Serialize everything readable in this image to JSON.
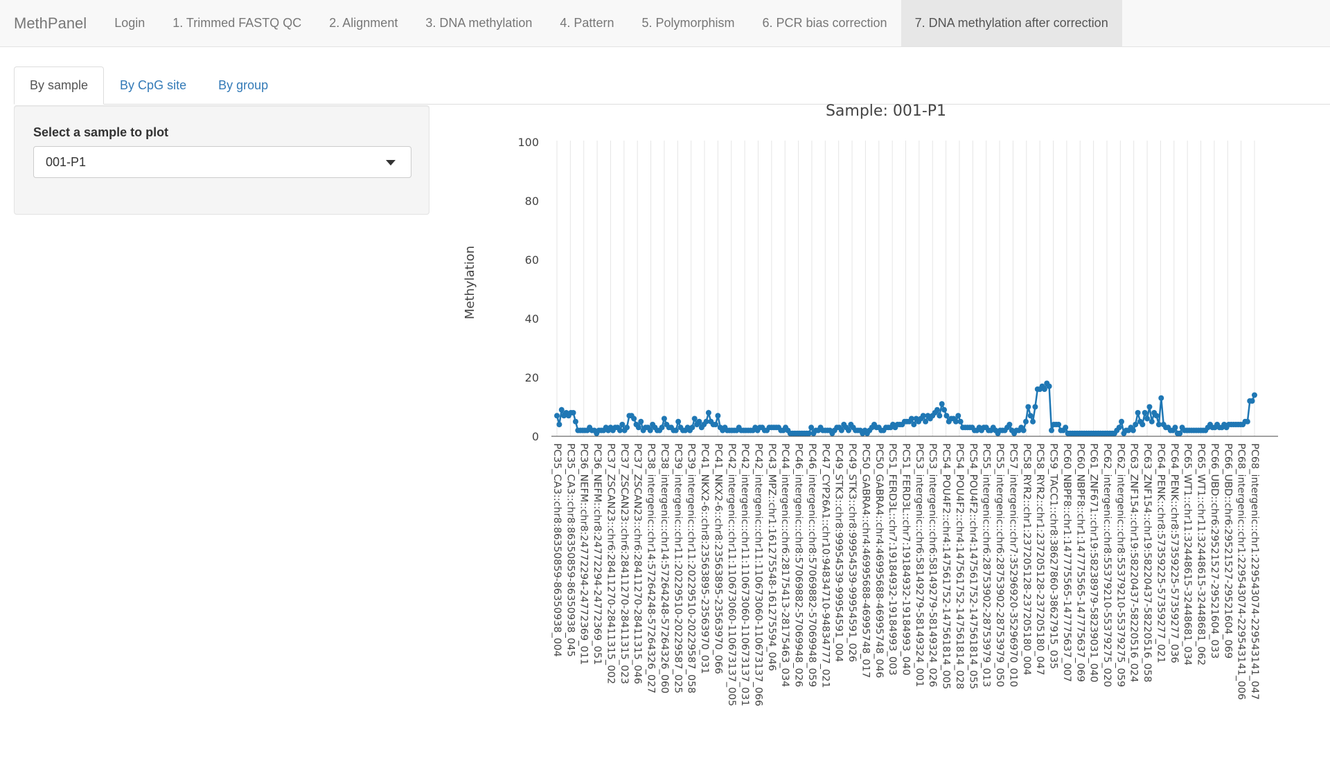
{
  "navbar": {
    "brand": "MethPanel",
    "items": [
      {
        "label": "Login"
      },
      {
        "label": "1. Trimmed FASTQ QC"
      },
      {
        "label": "2. Alignment"
      },
      {
        "label": "3. DNA methylation"
      },
      {
        "label": "4. Pattern"
      },
      {
        "label": "5. Polymorphism"
      },
      {
        "label": "6. PCR bias correction"
      },
      {
        "label": "7. DNA methylation after correction"
      }
    ],
    "active_index": 7
  },
  "tabs": [
    {
      "label": "By sample"
    },
    {
      "label": "By CpG site"
    },
    {
      "label": "By group"
    }
  ],
  "sidebar": {
    "label": "Select a sample to plot",
    "selected": "001-P1"
  },
  "colors": {
    "line": "#1f77b4",
    "grid": "#e5e5e5",
    "link": "#337ab7"
  },
  "chart_data": {
    "type": "line",
    "title": "Sample: 001-P1",
    "xlabel": "",
    "ylabel": "Methylation",
    "ylim": [
      0,
      100
    ],
    "yticks": [
      0,
      20,
      40,
      60,
      80,
      100
    ],
    "grid": "vertical",
    "markers": true,
    "x_tick_labels": [
      "PC35_CA3::chr8:86350859-86350938_004",
      "PC35_CA3::chr8:86350859-86350938_045",
      "PC36_NEFM::chr8:24772294-24772369_011",
      "PC36_NEFM::chr8:24772294-24772369_051",
      "PC37_ZSCAN23::chr6:28411270-28411315_002",
      "PC37_ZSCAN23::chr6:28411270-28411315_023",
      "PC37_ZSCAN23::chr6:28411270-28411315_046",
      "PC38_intergenic::chr14:57264248-57264326_027",
      "PC38_intergenic::chr14:57264248-57264326_060",
      "PC39_intergenic::chr11:20229510-20229587_025",
      "PC39_intergenic::chr11:20229510-20229587_058",
      "PC41_NKX2-6::chr8:23563895-23563970_031",
      "PC41_NKX2-6::chr8:23563895-23563970_066",
      "PC42_intergenic::chr11:110673060-110673137_005",
      "PC42_intergenic::chr11:110673060-110673137_031",
      "PC42_intergenic::chr11:110673060-110673137_066",
      "PC43_MPZ::chr1:161275548-161275594_046",
      "PC44_intergenic::chr6:28175413-28175463_034",
      "PC46_intergenic::chr8:57069882-57069948_026",
      "PC46_intergenic::chr8:57069882-57069948_059",
      "PC47_CYP26A1::chr10:94834710-94834777_021",
      "PC49_STK3::chr8:99954539-99954591_004",
      "PC49_STK3::chr8:99954539-99954591_026",
      "PC50_GABRA4::chr4:46995688-46995748_017",
      "PC50_GABRA4::chr4:46995688-46995748_046",
      "PC51_FERD3L::chr7:19184932-19184993_003",
      "PC51_FERD3L::chr7:19184932-19184993_040",
      "PC53_intergenic::chr6:58149279-58149324_001",
      "PC53_intergenic::chr6:58149279-58149324_026",
      "PC54_POU4F2::chr4:147561752-147561814_005",
      "PC54_POU4F2::chr4:147561752-147561814_028",
      "PC54_POU4F2::chr4:147561752-147561814_055",
      "PC55_intergenic::chr6:28753902-28753979_013",
      "PC55_intergenic::chr6:28753902-28753979_050",
      "PC57_intergenic::chr7:35296920-35296970_010",
      "PC58_RYR2::chr1:237205128-237205180_004",
      "PC58_RYR2::chr1:237205128-237205180_047",
      "PC59_TACC1::chr8:38627860-38627915_035",
      "PC60_NBPF8::chr1:147775565-147775637_007",
      "PC60_NBPF8::chr1:147775565-147775637_069",
      "PC61_ZNF671::chr19:58238979-58239031_040",
      "PC62_intergenic::chr8:55379210-55379275_020",
      "PC62_intergenic::chr8:55379210-55379275_059",
      "PC63_ZNF154::chr19:58220437-58220516_024",
      "PC63_ZNF154::chr19:58220437-58220516_058",
      "PC64_PENK::chr8:57359225-57359277_021",
      "PC64_PENK::chr8:57359225-57359277_036",
      "PC65_WT1::chr11:32448615-32448681_034",
      "PC65_WT1::chr11:32448615-32448681_062",
      "PC66_UBD::chr6:29521527-29521604_033",
      "PC66_UBD::chr6:29521527-29521604_069",
      "PC68_intergenic::chr1:229543074-229543141_006",
      "PC68_intergenic::chr1:229543074-229543141_047"
    ],
    "series": [
      {
        "values": [
          7,
          4,
          9,
          7,
          8,
          7,
          8,
          8,
          5,
          2,
          2,
          2,
          2,
          2,
          3,
          2,
          2,
          1,
          2,
          2,
          2,
          3,
          2,
          3,
          2,
          3,
          3,
          2,
          4,
          2,
          3,
          7,
          7,
          6,
          4,
          3,
          5,
          2,
          3,
          3,
          2,
          4,
          3,
          2,
          2,
          3,
          6,
          4,
          3,
          3,
          2,
          2,
          5,
          3,
          2,
          2,
          3,
          2,
          3,
          6,
          4,
          5,
          3,
          4,
          5,
          8,
          5,
          4,
          4,
          7,
          3,
          2,
          3,
          2,
          2,
          2,
          2,
          2,
          3,
          2,
          2,
          2,
          2,
          2,
          2,
          3,
          2,
          3,
          3,
          2,
          2,
          3,
          3,
          3,
          3,
          3,
          2,
          2,
          3,
          2,
          1,
          1,
          1,
          1,
          1,
          1,
          1,
          1,
          1,
          3,
          1,
          2,
          2,
          3,
          2,
          2,
          2,
          2,
          1,
          2,
          3,
          3,
          2,
          4,
          3,
          2,
          4,
          3,
          2,
          2,
          2,
          1,
          2,
          1,
          2,
          3,
          4,
          3,
          3,
          2,
          2,
          3,
          3,
          3,
          4,
          3,
          4,
          4,
          4,
          5,
          5,
          5,
          6,
          4,
          6,
          5,
          6,
          7,
          5,
          7,
          6,
          7,
          8,
          9,
          7,
          11,
          9,
          7,
          5,
          6,
          6,
          5,
          7,
          5,
          3,
          3,
          3,
          3,
          3,
          2,
          2,
          3,
          2,
          3,
          3,
          2,
          2,
          3,
          2,
          1,
          2,
          2,
          2,
          3,
          4,
          2,
          1,
          2,
          2,
          3,
          2,
          5,
          10,
          7,
          5,
          10,
          16,
          16,
          17,
          16,
          18,
          17,
          2,
          4,
          4,
          4,
          2,
          2,
          3,
          1,
          1,
          1,
          1,
          1,
          1,
          1,
          1,
          1,
          1,
          1,
          1,
          1,
          1,
          1,
          1,
          1,
          1,
          1,
          1,
          1,
          2,
          3,
          5,
          1,
          2,
          2,
          3,
          2,
          4,
          8,
          5,
          4,
          8,
          6,
          10,
          5,
          8,
          7,
          4,
          13,
          4,
          3,
          3,
          2,
          2,
          3,
          1,
          1,
          3,
          2,
          2,
          2,
          2,
          2,
          2,
          2,
          2,
          2,
          2,
          3,
          4,
          3,
          3,
          4,
          3,
          3,
          4,
          3,
          4,
          4,
          4,
          4,
          4,
          4,
          4,
          5,
          5,
          12,
          12,
          14
        ]
      }
    ]
  }
}
